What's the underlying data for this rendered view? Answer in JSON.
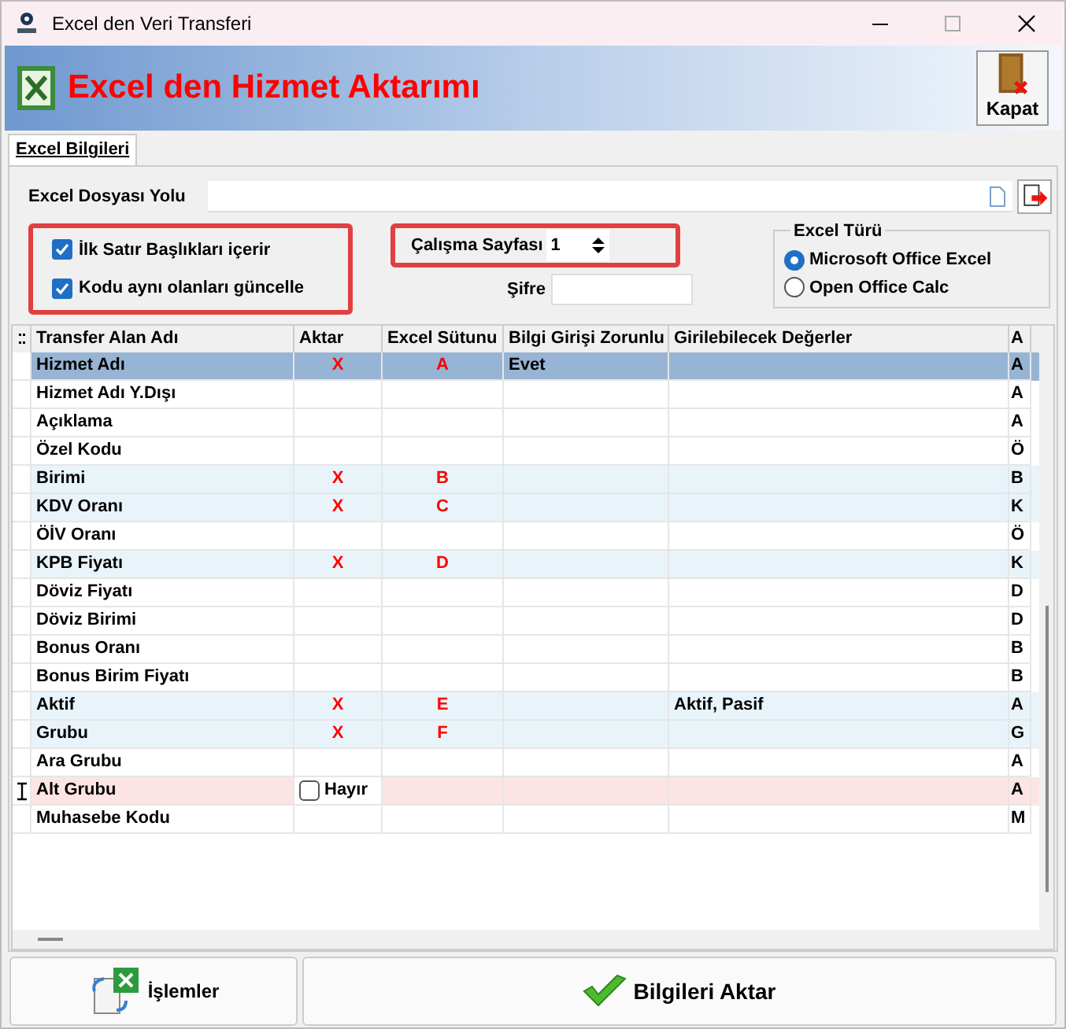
{
  "window": {
    "title": "Excel den Veri Transferi"
  },
  "header": {
    "title": "Excel den Hizmet Aktarımı",
    "close_button": "Kapat"
  },
  "tabs": [
    {
      "label": "Excel Bilgileri",
      "selected": true
    }
  ],
  "file_path": {
    "label": "Excel Dosyası Yolu"
  },
  "options": [
    {
      "label": "İlk Satır Başlıkları içerir",
      "checked": true
    },
    {
      "label": "Kodu aynı olanları güncelle",
      "checked": true
    }
  ],
  "sheet": {
    "label": "Çalışma Sayfası",
    "value": "1"
  },
  "password": {
    "label": "Şifre"
  },
  "excel_type": {
    "title": "Excel Türü",
    "options": [
      {
        "label": "Microsoft Office Excel",
        "selected": true
      },
      {
        "label": "Open Office Calc",
        "selected": false
      }
    ]
  },
  "table": {
    "columns": [
      "Transfer Alan Adı",
      "Aktar",
      "Excel Sütunu",
      "Bilgi Girişi Zorunlu",
      "Girilebilecek Değerler",
      "A"
    ],
    "rows": [
      {
        "kind": "plain",
        "selected": true,
        "current": false,
        "cells": [
          "Hizmet Adı",
          "X",
          "A",
          "Evet",
          "",
          "A"
        ]
      },
      {
        "kind": "plain",
        "selected": false,
        "current": false,
        "cells": [
          "Hizmet Adı Y.Dışı",
          "",
          "",
          "",
          "",
          "A"
        ]
      },
      {
        "kind": "plain",
        "selected": false,
        "current": false,
        "cells": [
          "Açıklama",
          "",
          "",
          "",
          "",
          "A"
        ]
      },
      {
        "kind": "plain",
        "selected": false,
        "current": false,
        "cells": [
          "Özel Kodu",
          "",
          "",
          "",
          "",
          "Ö"
        ]
      },
      {
        "kind": "mapped",
        "selected": false,
        "current": false,
        "cells": [
          "Birimi",
          "X",
          "B",
          "",
          "",
          "B"
        ]
      },
      {
        "kind": "mapped",
        "selected": false,
        "current": false,
        "cells": [
          "KDV Oranı",
          "X",
          "C",
          "",
          "",
          "K"
        ]
      },
      {
        "kind": "plain",
        "selected": false,
        "current": false,
        "cells": [
          "ÖİV Oranı",
          "",
          "",
          "",
          "",
          "Ö"
        ]
      },
      {
        "kind": "mapped",
        "selected": false,
        "current": false,
        "cells": [
          "KPB Fiyatı",
          "X",
          "D",
          "",
          "",
          "K"
        ]
      },
      {
        "kind": "plain",
        "selected": false,
        "current": false,
        "cells": [
          "Döviz Fiyatı",
          "",
          "",
          "",
          "",
          "D"
        ]
      },
      {
        "kind": "plain",
        "selected": false,
        "current": false,
        "cells": [
          "Döviz Birimi",
          "",
          "",
          "",
          "",
          "D"
        ]
      },
      {
        "kind": "plain",
        "selected": false,
        "current": false,
        "cells": [
          "Bonus Oranı",
          "",
          "",
          "",
          "",
          "B"
        ]
      },
      {
        "kind": "plain",
        "selected": false,
        "current": false,
        "cells": [
          "Bonus Birim Fiyatı",
          "",
          "",
          "",
          "",
          "B"
        ]
      },
      {
        "kind": "mapped",
        "selected": false,
        "current": false,
        "cells": [
          "Aktif",
          "X",
          "E",
          "",
          "Aktif, Pasif",
          "A"
        ]
      },
      {
        "kind": "mapped",
        "selected": false,
        "current": false,
        "cells": [
          "Grubu",
          "X",
          "F",
          "",
          "",
          "G"
        ]
      },
      {
        "kind": "plain",
        "selected": false,
        "current": false,
        "cells": [
          "Ara Grubu",
          "",
          "",
          "",
          "",
          "A"
        ]
      },
      {
        "kind": "editing",
        "selected": false,
        "current": true,
        "checked": false,
        "cells": [
          "Alt Grubu",
          "Hayır",
          "",
          "",
          "",
          "A"
        ]
      },
      {
        "kind": "plain",
        "selected": false,
        "current": false,
        "cells": [
          "Muhasebe Kodu",
          "",
          "",
          "",
          "",
          "M"
        ]
      }
    ]
  },
  "buttons": [
    {
      "kind": "operations",
      "label": "İşlemler"
    },
    {
      "kind": "transfer",
      "label": "Bilgileri Aktar"
    }
  ]
}
